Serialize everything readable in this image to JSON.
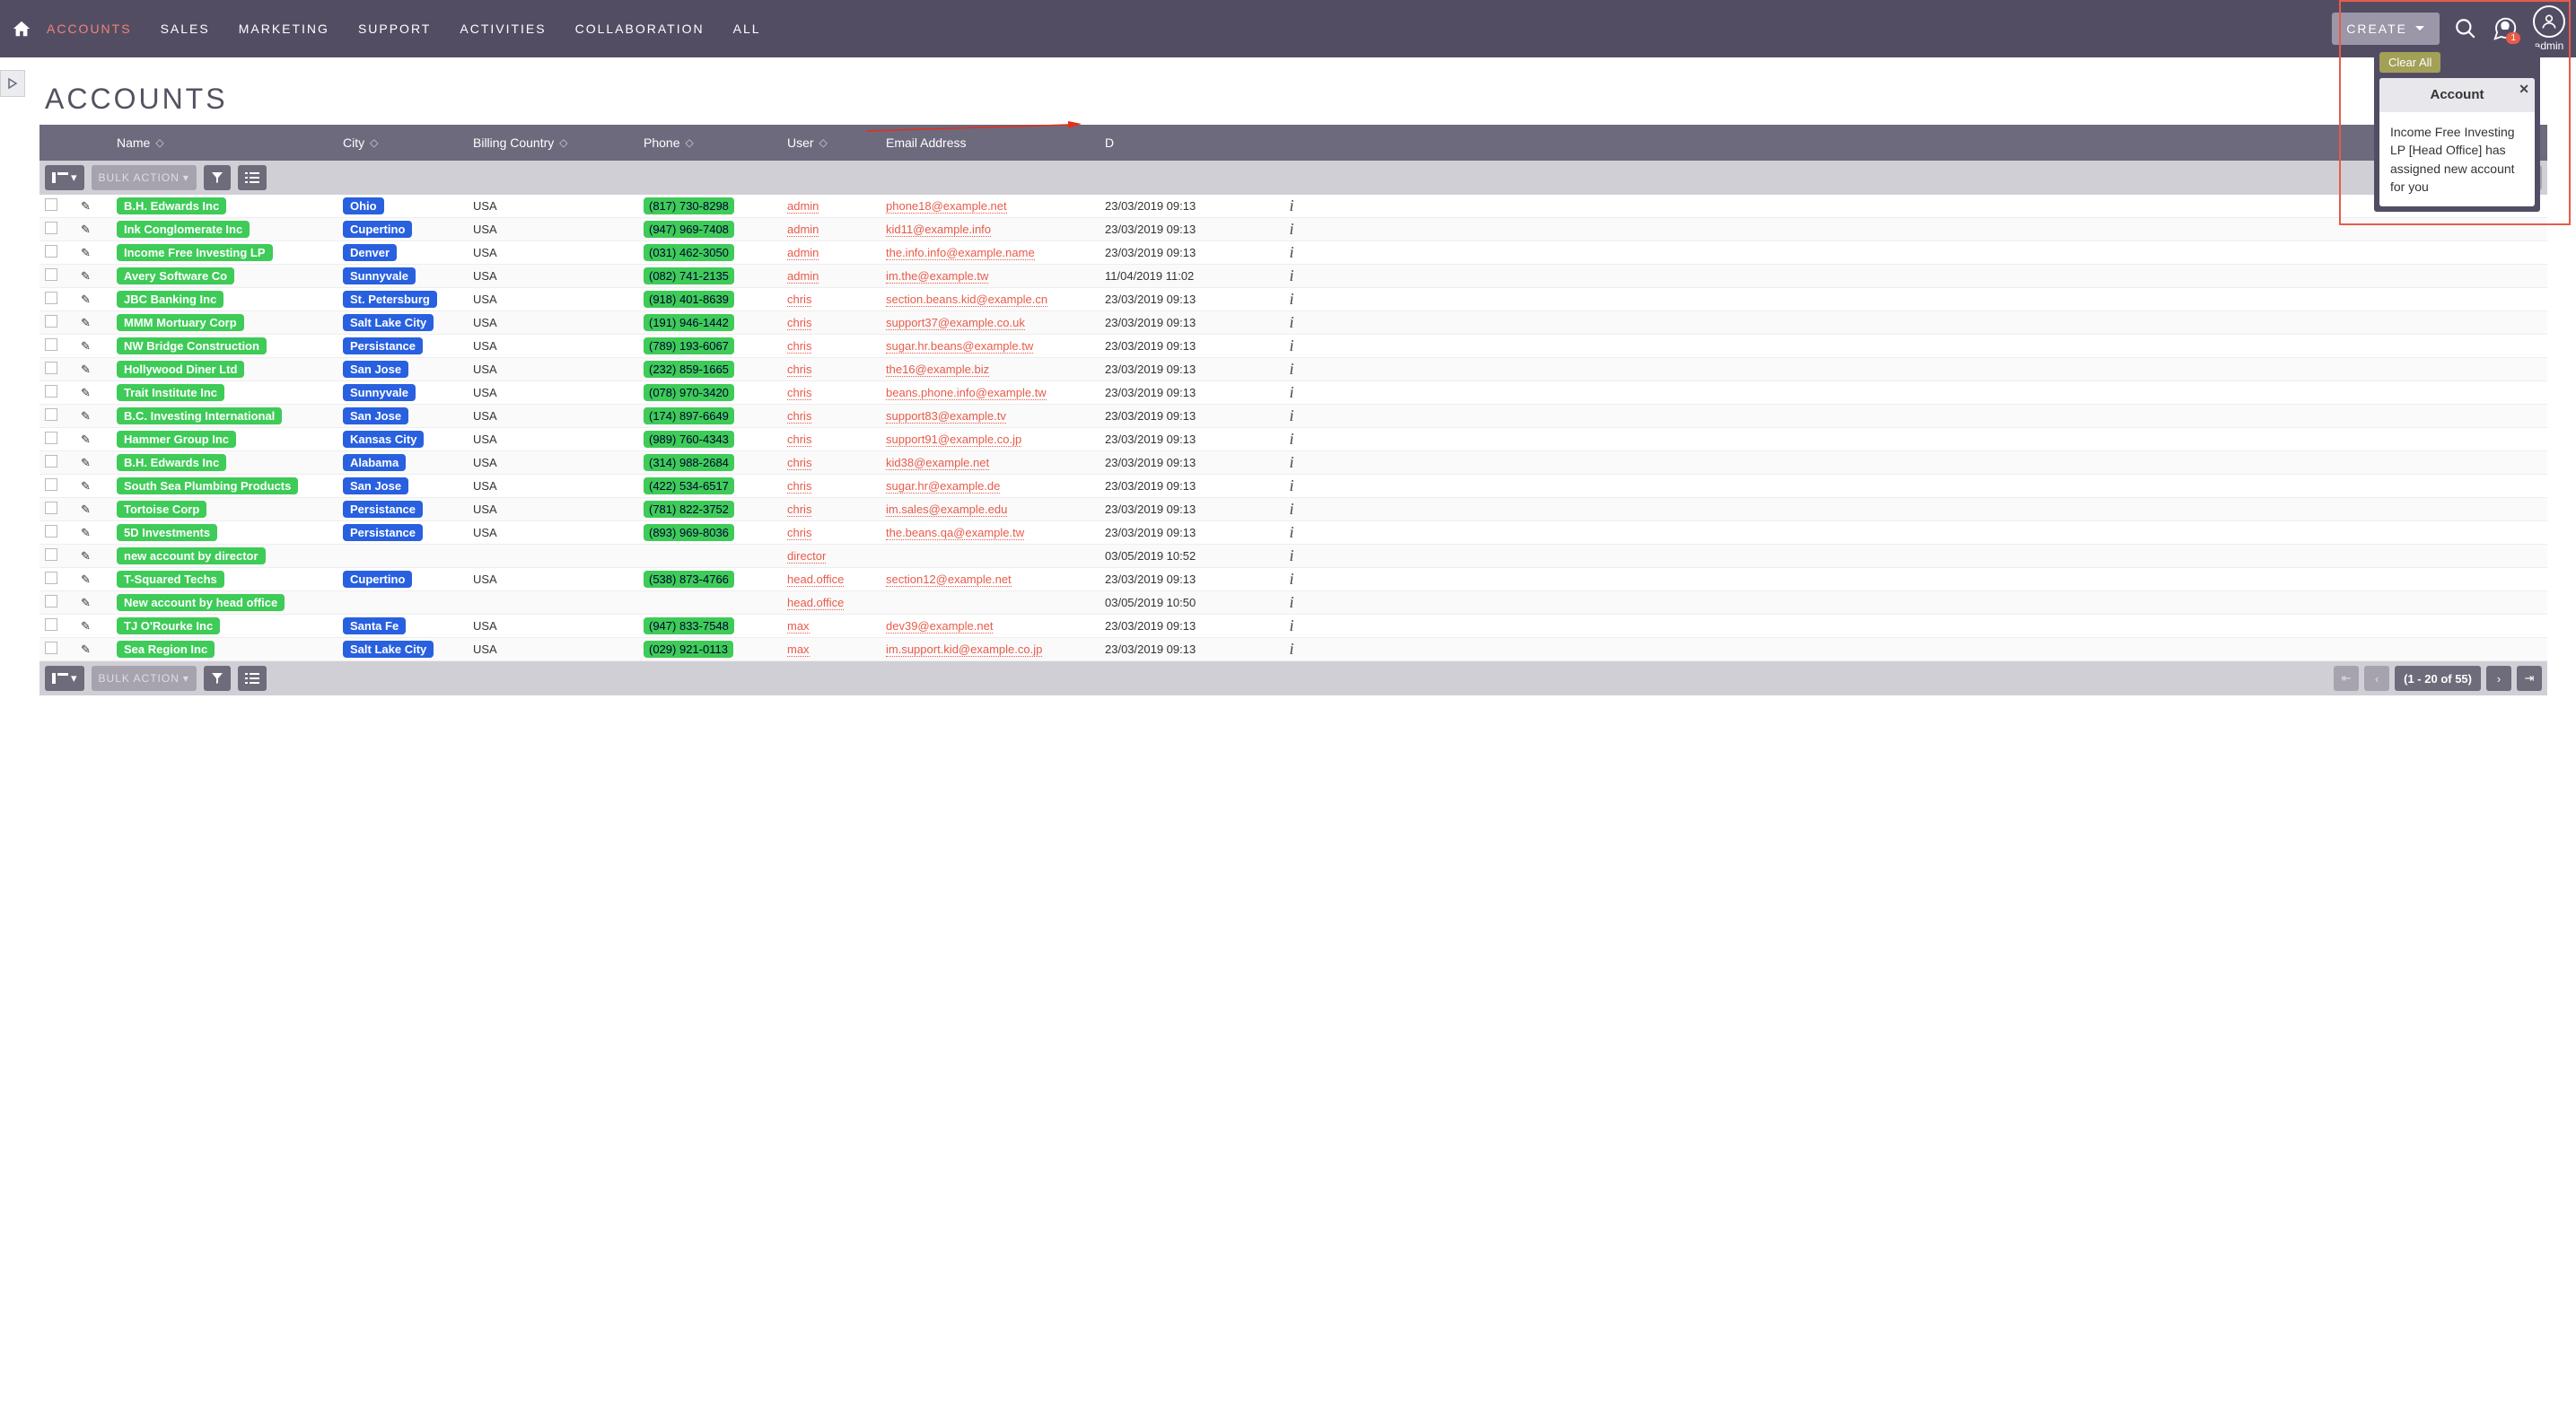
{
  "nav": {
    "items": [
      "ACCOUNTS",
      "SALES",
      "MARKETING",
      "SUPPORT",
      "ACTIVITIES",
      "COLLABORATION",
      "ALL"
    ],
    "active_index": 0,
    "create_label": "CREATE",
    "user_label": "admin",
    "notif_count": "1"
  },
  "notif": {
    "clear_all": "Clear All",
    "title": "Account",
    "body": "Income Free Investing LP [Head Office] has assigned new account for you"
  },
  "page": {
    "title": "ACCOUNTS"
  },
  "columns": {
    "name": "Name",
    "city": "City",
    "country": "Billing Country",
    "phone": "Phone",
    "user": "User",
    "email": "Email Address",
    "date_prefix": "D"
  },
  "toolbar": {
    "bulk": "BULK ACTION",
    "pagination_text": "(1 - 20 of 55)"
  },
  "rows": [
    {
      "name": "B.H. Edwards Inc",
      "city": "Ohio",
      "country": "USA",
      "phone": "(817) 730-8298",
      "user": "admin",
      "email": "phone18@example.net",
      "date": "23/03/2019 09:13"
    },
    {
      "name": "Ink Conglomerate Inc",
      "city": "Cupertino",
      "country": "USA",
      "phone": "(947) 969-7408",
      "user": "admin",
      "email": "kid11@example.info",
      "date": "23/03/2019 09:13"
    },
    {
      "name": "Income Free Investing LP",
      "city": "Denver",
      "country": "USA",
      "phone": "(031) 462-3050",
      "user": "admin",
      "email": "the.info.info@example.name",
      "date": "23/03/2019 09:13"
    },
    {
      "name": "Avery Software Co",
      "city": "Sunnyvale",
      "country": "USA",
      "phone": "(082) 741-2135",
      "user": "admin",
      "email": "im.the@example.tw",
      "date": "11/04/2019 11:02"
    },
    {
      "name": "JBC Banking Inc",
      "city": "St. Petersburg",
      "country": "USA",
      "phone": "(918) 401-8639",
      "user": "chris",
      "email": "section.beans.kid@example.cn",
      "date": "23/03/2019 09:13"
    },
    {
      "name": "MMM Mortuary Corp",
      "city": "Salt Lake City",
      "country": "USA",
      "phone": "(191) 946-1442",
      "user": "chris",
      "email": "support37@example.co.uk",
      "date": "23/03/2019 09:13"
    },
    {
      "name": "NW Bridge Construction",
      "city": "Persistance",
      "country": "USA",
      "phone": "(789) 193-6067",
      "user": "chris",
      "email": "sugar.hr.beans@example.tw",
      "date": "23/03/2019 09:13"
    },
    {
      "name": "Hollywood Diner Ltd",
      "city": "San Jose",
      "country": "USA",
      "phone": "(232) 859-1665",
      "user": "chris",
      "email": "the16@example.biz",
      "date": "23/03/2019 09:13"
    },
    {
      "name": "Trait Institute Inc",
      "city": "Sunnyvale",
      "country": "USA",
      "phone": "(078) 970-3420",
      "user": "chris",
      "email": "beans.phone.info@example.tw",
      "date": "23/03/2019 09:13"
    },
    {
      "name": "B.C. Investing International",
      "city": "San Jose",
      "country": "USA",
      "phone": "(174) 897-6649",
      "user": "chris",
      "email": "support83@example.tv",
      "date": "23/03/2019 09:13"
    },
    {
      "name": "Hammer Group Inc",
      "city": "Kansas City",
      "country": "USA",
      "phone": "(989) 760-4343",
      "user": "chris",
      "email": "support91@example.co.jp",
      "date": "23/03/2019 09:13"
    },
    {
      "name": "B.H. Edwards Inc",
      "city": "Alabama",
      "country": "USA",
      "phone": "(314) 988-2684",
      "user": "chris",
      "email": "kid38@example.net",
      "date": "23/03/2019 09:13"
    },
    {
      "name": "South Sea Plumbing Products",
      "city": "San Jose",
      "country": "USA",
      "phone": "(422) 534-6517",
      "user": "chris",
      "email": "sugar.hr@example.de",
      "date": "23/03/2019 09:13"
    },
    {
      "name": "Tortoise Corp",
      "city": "Persistance",
      "country": "USA",
      "phone": "(781) 822-3752",
      "user": "chris",
      "email": "im.sales@example.edu",
      "date": "23/03/2019 09:13"
    },
    {
      "name": "5D Investments",
      "city": "Persistance",
      "country": "USA",
      "phone": "(893) 969-8036",
      "user": "chris",
      "email": "the.beans.qa@example.tw",
      "date": "23/03/2019 09:13"
    },
    {
      "name": "new account by director",
      "city": "",
      "country": "",
      "phone": "",
      "user": "director",
      "email": "",
      "date": "03/05/2019 10:52"
    },
    {
      "name": "T-Squared Techs",
      "city": "Cupertino",
      "country": "USA",
      "phone": "(538) 873-4766",
      "user": "head.office",
      "email": "section12@example.net",
      "date": "23/03/2019 09:13"
    },
    {
      "name": "New account by head office",
      "city": "",
      "country": "",
      "phone": "",
      "user": "head.office",
      "email": "",
      "date": "03/05/2019 10:50"
    },
    {
      "name": "TJ O'Rourke Inc",
      "city": "Santa Fe",
      "country": "USA",
      "phone": "(947) 833-7548",
      "user": "max",
      "email": "dev39@example.net",
      "date": "23/03/2019 09:13"
    },
    {
      "name": "Sea Region Inc",
      "city": "Salt Lake City",
      "country": "USA",
      "phone": "(029) 921-0113",
      "user": "max",
      "email": "im.support.kid@example.co.jp",
      "date": "23/03/2019 09:13"
    }
  ]
}
